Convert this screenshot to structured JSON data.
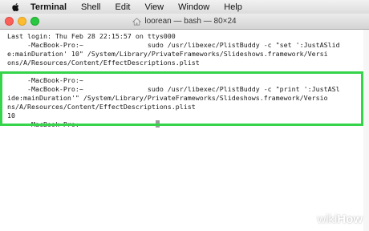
{
  "menubar": {
    "items": [
      "Terminal",
      "Shell",
      "Edit",
      "View",
      "Window",
      "Help"
    ]
  },
  "window": {
    "title": "loorean — bash — 80×24"
  },
  "terminal": {
    "lines": [
      "Last login: Thu Feb 28 22:15:57 on ttys000",
      "     -MacBook-Pro:~                sudo /usr/libexec/PlistBuddy -c \"set ':JustASlid",
      "e:mainDuration' 10\" /System/Library/PrivateFrameworks/Slideshows.framework/Versi",
      "ons/A/Resources/Content/EffectDescriptions.plist",
      "     -MacBook-Pro:~",
      "     -MacBook-Pro:~                sudo /usr/libexec/PlistBuddy -c \"print ':JustASl",
      "ide:mainDuration'\" /System/Library/PrivateFrameworks/Slideshows.framework/Versio",
      "ns/A/Resources/Content/EffectDescriptions.plist",
      "10",
      "     -MacBook-Pro:~"
    ]
  },
  "watermark": {
    "wiki": "wiki",
    "how": "How"
  },
  "colors": {
    "highlight": "#35d44a",
    "close": "#fc5f57",
    "minimize": "#fdbc2e",
    "zoom": "#29c840"
  }
}
